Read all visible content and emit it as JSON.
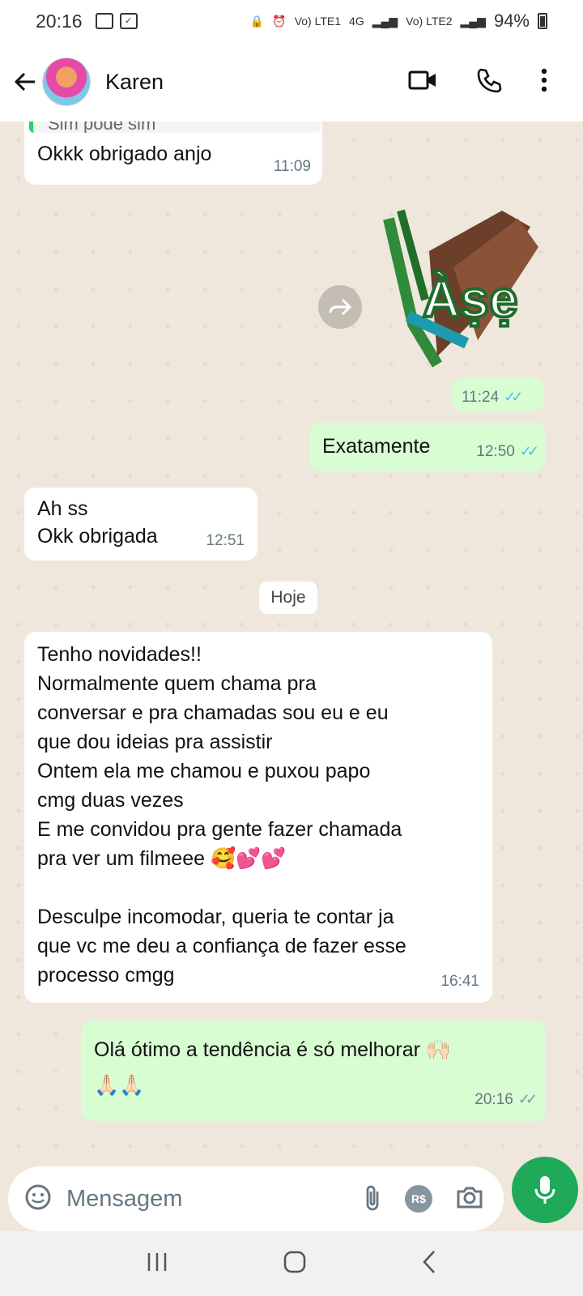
{
  "status": {
    "time": "20:16",
    "net1": "Vo) LTE1",
    "net_type": "4G",
    "net2": "Vo) LTE2",
    "battery": "94%"
  },
  "header": {
    "contact_name": "Karen"
  },
  "messages": {
    "m1": {
      "quote": "Sim pode sim",
      "text": "Okkk obrigado anjo",
      "time": "11:09"
    },
    "m2": {
      "sticker_text": "Àṣẹ",
      "time": "11:24"
    },
    "m3": {
      "text": "Exatamente",
      "time": "12:50"
    },
    "m4": {
      "line1": "Ah ss",
      "line2": "Okk obrigada",
      "time": "12:51"
    },
    "day_label": "Hoje",
    "m5": {
      "lines": [
        "Tenho novidades!!",
        "Normalmente quem chama pra",
        "conversar e pra chamadas sou eu e eu",
        "que dou ideias pra assistir",
        "Ontem ela me chamou e puxou papo",
        "cmg duas vezes",
        "E me convidou pra gente fazer chamada",
        "pra ver um filmeee 🥰💕💕",
        "",
        "Desculpe incomodar, queria te contar ja",
        "que vc me deu a confiança de fazer esse",
        "processo cmgg"
      ],
      "time": "16:41"
    },
    "m6": {
      "line1": "Olá ótimo a tendência é só melhorar 🙌🏻",
      "line2": "🙏🏻🙏🏻",
      "time": "20:16"
    }
  },
  "input": {
    "placeholder": "Mensagem",
    "pay_label": "R$"
  },
  "colors": {
    "accent": "#1faa59",
    "outgoing": "#d9fdd3",
    "incoming": "#ffffff",
    "read_ticks": "#53bdeb"
  }
}
